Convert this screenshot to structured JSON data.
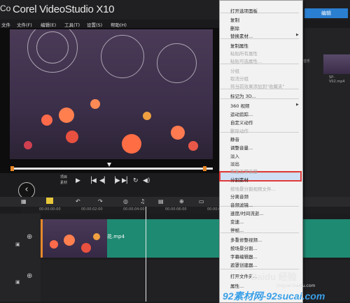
{
  "titlebar": {
    "app_fragment": "Co",
    "title": "Corel VideoStudio X10",
    "edit_button": "编辑"
  },
  "menubar": {
    "items": [
      "文件",
      "文件(F)",
      "编辑(E)",
      "工具(T)",
      "设置(S)",
      "帮助(H)"
    ]
  },
  "preview": {
    "mode_project": "项目",
    "mode_clip": "素材"
  },
  "library": {
    "thumb_label": "SP-V02.mp4",
    "side_label": "音乐"
  },
  "ruler": {
    "ticks": [
      "00:00:00:00",
      "00:00:02:00",
      "00:00:04:00",
      "00:00:06:00",
      "00:00:08:00"
    ]
  },
  "timeline": {
    "clip_name": "花.mp4"
  },
  "context_menu": {
    "items": [
      {
        "label": "打开选项面板",
        "enabled": true
      },
      {
        "label": "复制",
        "enabled": true
      },
      {
        "label": "删除",
        "enabled": true
      },
      {
        "label": "替换素材...",
        "enabled": true,
        "submenu": true
      },
      {
        "label": "复制属性",
        "enabled": true
      },
      {
        "label": "粘贴所有属性",
        "enabled": false
      },
      {
        "label": "粘贴可选属性...",
        "enabled": false
      },
      {
        "label": "分组",
        "enabled": false
      },
      {
        "label": "取消分组",
        "enabled": false
      },
      {
        "label": "将当前效果添加到\"收藏夹\"",
        "enabled": false
      },
      {
        "label": "标记为 3D...",
        "enabled": true
      },
      {
        "label": "360 视频",
        "enabled": true,
        "submenu": true
      },
      {
        "label": "运动追踪...",
        "enabled": true
      },
      {
        "label": "自定义动作",
        "enabled": true
      },
      {
        "label": "删除动作",
        "enabled": false
      },
      {
        "label": "静音",
        "enabled": true
      },
      {
        "label": "调整音量...",
        "enabled": true
      },
      {
        "label": "淡入",
        "enabled": true
      },
      {
        "label": "淡出",
        "enabled": true
      },
      {
        "label": "恢复正常音量",
        "enabled": false
      },
      {
        "label": "分割素材",
        "enabled": true,
        "highlighted": true
      },
      {
        "label": "按场景分割视频文件...",
        "enabled": false
      },
      {
        "label": "分离音频",
        "enabled": true
      },
      {
        "label": "音频滤镜...",
        "enabled": true
      },
      {
        "label": "速度/时间流逝...",
        "enabled": true
      },
      {
        "label": "变速...",
        "enabled": true
      },
      {
        "label": "停帧...",
        "enabled": true
      },
      {
        "label": "多重修整视频...",
        "enabled": true
      },
      {
        "label": "按场景分割...",
        "enabled": true
      },
      {
        "label": "字幕编辑器...",
        "enabled": true
      },
      {
        "label": "遮罩创建器...",
        "enabled": true
      },
      {
        "label": "打开文件夹...",
        "enabled": true
      },
      {
        "label": "属性...",
        "enabled": true
      }
    ]
  },
  "watermark": {
    "brand": "Baidu 经验",
    "sub": "jingyan.baidu.com",
    "site": "92素材网-92sucai.com"
  },
  "colors": {
    "accent": "#2b7fd0",
    "clip_track": "#1f8a72",
    "highlight_border": "#e03b3b",
    "marker": "#e8892a"
  }
}
